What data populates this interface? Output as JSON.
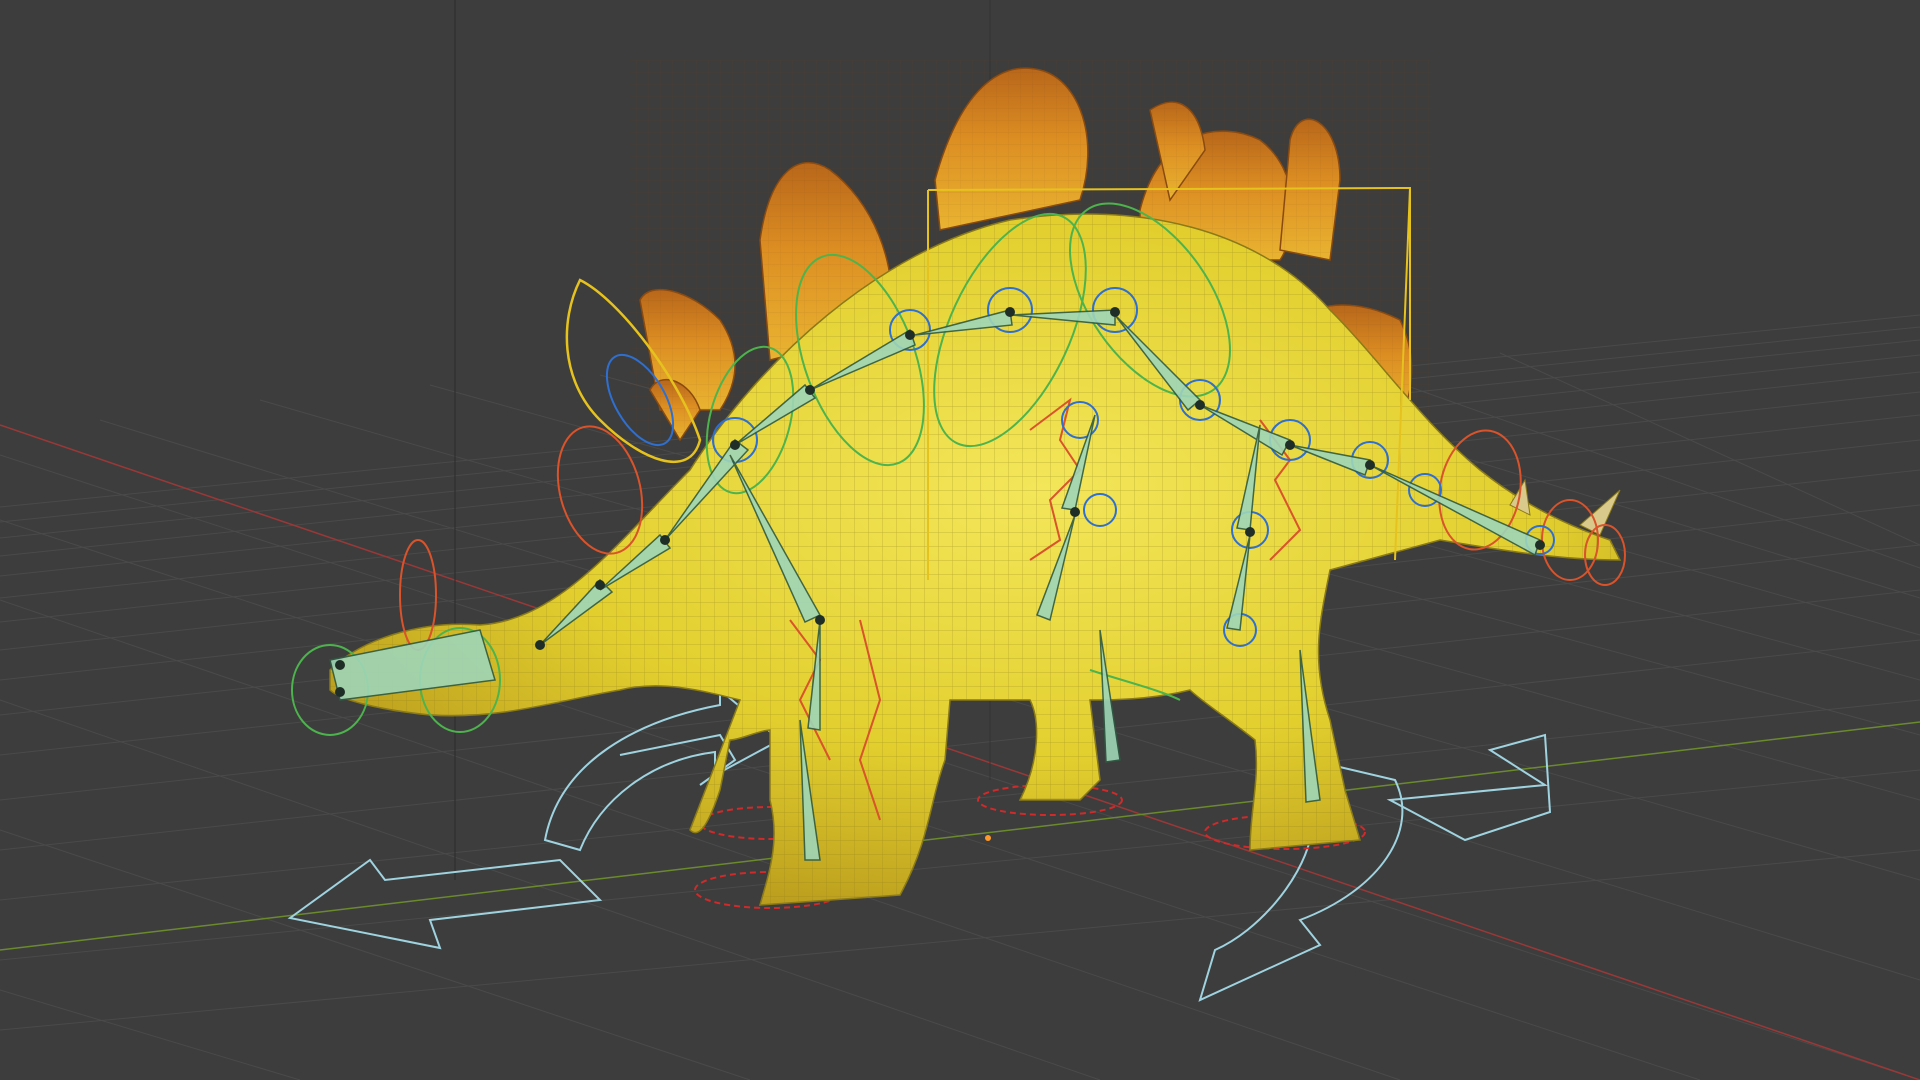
{
  "viewport": {
    "background": "#3d3d3d",
    "grid_color": "#4a4a4a",
    "x_axis_color": "#9a3838",
    "y_axis_color": "#6b8a2e",
    "object_color": "#e6d83a",
    "plate_color": "#d98a1e",
    "bone_color": "#9fd6b8",
    "rig_colors": {
      "selected_box": "#e6c21e",
      "fk_ctrl": "#4db34d",
      "ik_ctrl": "#d9532b",
      "spine_ctrl": "#2f6fd0",
      "root_ctrl": "#9fd3e0",
      "foot_ctrl": "#d02a2a"
    },
    "icons": [
      "3d-cursor-icon"
    ]
  }
}
